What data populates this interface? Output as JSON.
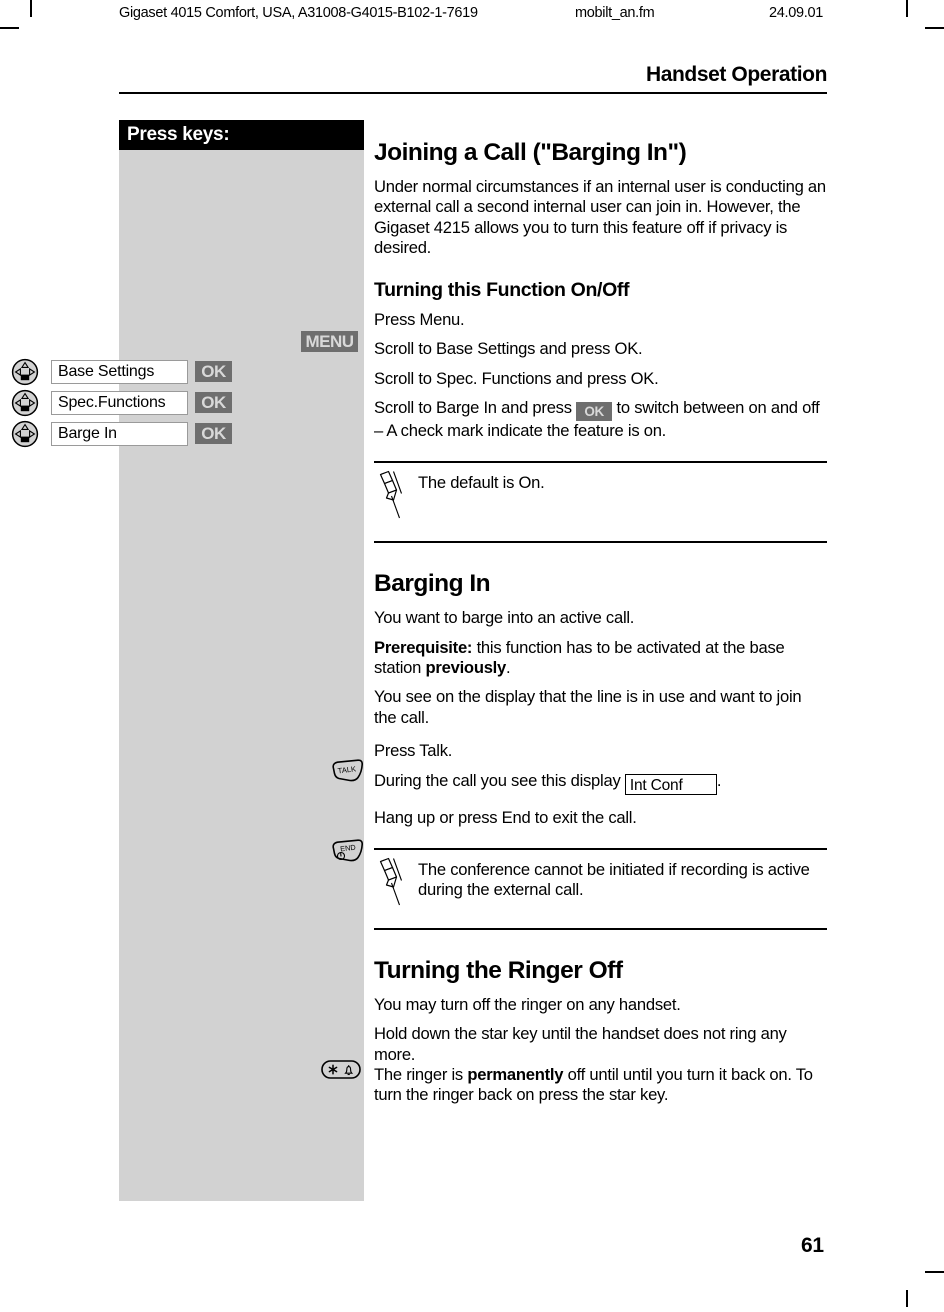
{
  "print_header": {
    "document": "Gigaset 4015 Comfort, USA, A31008-G4015-B102-1-7619",
    "filename": "mobilt_an.fm",
    "date": "24.09.01"
  },
  "running_head": "Handset Operation",
  "page_number": "61",
  "keys_column": {
    "title": "Press keys:",
    "menu_softkey": "MENU",
    "rows": [
      {
        "field": "Base Settings",
        "softkey": "OK",
        "key_icon": "navigation-key-icon"
      },
      {
        "field": "Spec.Functions",
        "softkey": "OK",
        "key_icon": "navigation-key-icon"
      },
      {
        "field": "Barge In",
        "softkey": "OK",
        "key_icon": "navigation-key-icon"
      }
    ],
    "talk_key": "TALK",
    "end_key": "END",
    "star_key": "star-ringer-key-icon"
  },
  "main": {
    "h_joining": "Joining a Call (\"Barging In\")",
    "p_intro": "Under normal circumstances if an internal user is conducting an external call a second internal user can join in.  However, the Gigaset 4215 allows you to turn this feature off if privacy is desired.",
    "h_turning": "Turning this Function On/Off",
    "p_press_menu": "Press Menu.",
    "p_scroll_base": "Scroll to Base Settings and press OK.",
    "p_scroll_spec": "Scroll to Spec. Functions and press OK.",
    "p_scroll_barge_pre": "Scroll to Barge In and press",
    "p_scroll_barge_chip": "OK",
    "p_scroll_barge_post": "to switch between on and off – A check mark indicate the feature is on.",
    "note_default": "The default is On.",
    "h_barging": "Barging In",
    "p_barge_want": "You want to barge into an active call.",
    "p_prereq_bold": "Prerequisite:",
    "p_prereq_mid": " this function has to be activated at the base station ",
    "p_prereq_bold2": "previously",
    "p_prereq_end": ".",
    "p_display_line": "You see on the display that the line is in use and want to join the call.",
    "p_press_talk": "Press Talk.",
    "p_during_pre": "During the call you see this display",
    "p_during_display": "Int Conf",
    "p_during_post": ".",
    "p_hang_up": "Hang up or press End to exit the call.",
    "note_conference": "The conference cannot be initiated if recording is active during the external call.",
    "h_ringer": "Turning the Ringer Off",
    "p_ringer_any": "You may turn off the ringer on any handset.",
    "p_ringer_hold": "Hold down the star key until the handset does not ring any more.",
    "p_ringer_perm_pre": "The ringer is ",
    "p_ringer_perm_bold": "permanently",
    "p_ringer_perm_post": " off until until you turn it back on. To turn the ringer back on press the star key."
  },
  "colors": {
    "sidebar_bg": "#d2d2d2",
    "title_bg": "#000000",
    "softkey_bg": "#6e6e6e",
    "softkey_fg": "#d8d8d8"
  }
}
